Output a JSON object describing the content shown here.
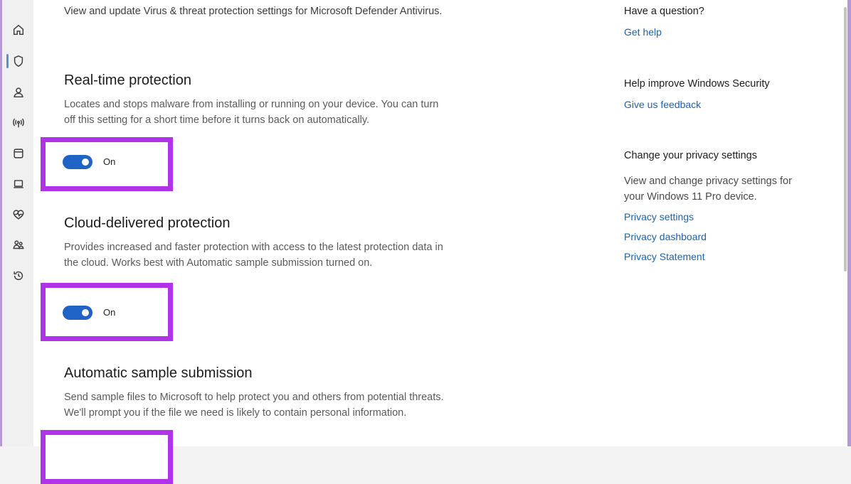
{
  "sidebar": {
    "items": [
      {
        "icon": "home-icon"
      },
      {
        "icon": "shield-icon",
        "active": true
      },
      {
        "icon": "account-icon"
      },
      {
        "icon": "network-icon"
      },
      {
        "icon": "app-browser-icon"
      },
      {
        "icon": "device-security-icon"
      },
      {
        "icon": "health-icon"
      },
      {
        "icon": "family-icon"
      },
      {
        "icon": "history-icon"
      }
    ],
    "accent": "#5b8fd1"
  },
  "main": {
    "intro": "View and update Virus & threat protection settings for Microsoft Defender Antivirus.",
    "sections": [
      {
        "title": "Real-time protection",
        "description": "Locates and stops malware from installing or running on your device. You can turn off this setting for a short time before it turns back on automatically.",
        "toggle_state": "On"
      },
      {
        "title": "Cloud-delivered protection",
        "description": "Provides increased and faster protection with access to the latest protection data in the cloud. Works best with Automatic sample submission turned on.",
        "toggle_state": "On"
      },
      {
        "title": "Automatic sample submission",
        "description": "Send sample files to Microsoft to help protect you and others from potential threats. We'll prompt you if the file we need is likely to contain personal information."
      }
    ],
    "highlight_color": "#b033e8",
    "toggle_color": "#1f63c6"
  },
  "right_panel": {
    "question_heading": "Have a question?",
    "get_help": "Get help",
    "improve_heading": "Help improve Windows Security",
    "feedback_link": "Give us feedback",
    "privacy_heading": "Change your privacy settings",
    "privacy_text": "View and change privacy settings for your Windows 11 Pro device.",
    "privacy_links": [
      "Privacy settings",
      "Privacy dashboard",
      "Privacy Statement"
    ],
    "link_color": "#1a62b4"
  }
}
